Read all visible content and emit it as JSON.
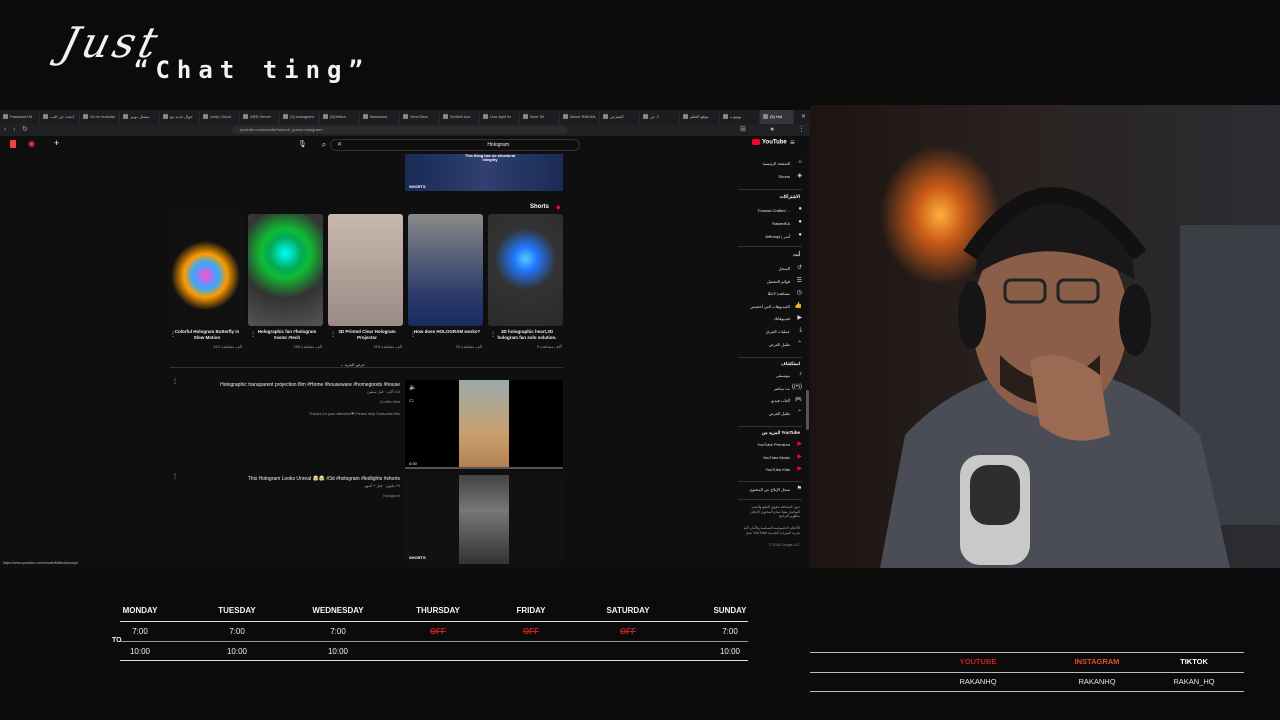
{
  "overlay": {
    "title_line1": "Just",
    "title_line2": "“Chat ting”"
  },
  "browser": {
    "tabs": [
      "Password M",
      "ابحث عن التب",
      "Go to recitatio",
      "مشغل نوبير",
      "جوال جديد مع",
      "Unity Cloud",
      "ARB Server",
      "(3) Instagram",
      "(8)Telbot",
      "Blackrock",
      "VirusTotal",
      "ScribAI doc",
      "Live April th",
      "Now Tel",
      "About RAKAN",
      "المعرض",
      "عن Z",
      "موقع التعلم",
      "يوتيوب",
      "(5) Hol"
    ],
    "url": "youtube.com/results?search_query=hologram+",
    "search_value": "Hologram",
    "yt_logo": "YouTube"
  },
  "results": {
    "top_short_caption": "This thing has no structural integrity",
    "shorts_label": "SHORTS",
    "shorts_header": "Shorts",
    "shorts": [
      {
        "title": "Colorful Hologram Butterfly in Slow Motion",
        "views": "812 ألف مشاهدة"
      },
      {
        "title": "Holographic fan #hologram #asmr #tech",
        "views": "288 ألف مشاهدة"
      },
      {
        "title": "3D Printed Clear Hologram Projector",
        "views": "318 ألف مشاهدة"
      },
      {
        "title": "How does HOLOGRAM works?",
        "views": "20 ألف مشاهدة"
      },
      {
        "title": "3D holographic heart,3D hologram fan solo solution.",
        "views": "9 آلاف مشاهدة"
      }
    ],
    "show_more": "عرض المزيد",
    "videos": [
      {
        "title": "Holographic transparent projection film #Home #houseware #homegoods #house",
        "meta": "١٤٨ ألف · قبل سنتين",
        "channel": "A Little Idea",
        "desc": "Thanks for your attention❤ Please help Subscribe this",
        "duration": "0:00"
      },
      {
        "title": "This Hologram Looks Unreal 🤯🤯 #3d #hologram #ledlights #shorts",
        "meta": "٢٧ مليون · قبل ٢ أشهر",
        "channel": "Hologlove",
        "desc": "",
        "duration": ""
      }
    ],
    "status_url": "https://www.youtube.com/shorts/M8kvw0uoxyA"
  },
  "sidebar": {
    "items1": [
      "الصفحة الرئيسية",
      "Shorts"
    ],
    "subs_header": "الاشتراكات",
    "subs": [
      "Tomass Crafted ...",
      "RawedKA",
      "Jeffumpi | أسر"
    ],
    "you_header": "أنت",
    "you_items": [
      "السجل",
      "قوائم التشغيل",
      "مشاهدة لاحقًا",
      "الفيديوهات التي أعجبتني",
      "فيديوهاتك",
      "عمليات التنزيل",
      "تقليل العرض"
    ],
    "explore_header": "استكشاف",
    "explore_items": [
      "موسيقى",
      "بث مباشر",
      "ألعاب فيديو",
      "تقليل العرض"
    ],
    "more_header": "المزيد من YouTube",
    "more_items": [
      "YouTube Premium",
      "YouTube Music",
      "YouTube Kids"
    ],
    "report": "سجل الإبلاغ عن المحتوى",
    "footer1": "حول  الصحافة  حقوق الطبع والنشر  التواصل معنا  صناع المحتوى  الإعلان  مطوّرو البرامج",
    "footer2": "الأحكام  الخصوصية  السياسة والأمان  آلية عمل YouTube  تجربة الميزات الجديدة",
    "copyright": "© 2024 Google LLC"
  },
  "schedule": {
    "days": [
      "MONDAY",
      "TUESDAY",
      "WEDNESDAY",
      "THURSDAY",
      "FRIDAY",
      "SATURDAY",
      "SUNDAY"
    ],
    "to_label": "TO",
    "start": [
      "7:00",
      "7:00",
      "7:00",
      "OFF",
      "OFF",
      "OFF",
      "7:00"
    ],
    "end": [
      "10:00",
      "10:00",
      "10:00",
      "",
      "",
      "",
      "10:00"
    ]
  },
  "socials": {
    "platforms": [
      "YOUTUBE",
      "INSTAGRAM",
      "TIKTOK"
    ],
    "handles": [
      "RAKANHQ",
      "RAKANHQ",
      "RAKAN_HQ"
    ],
    "colors": [
      "#cc1f1f",
      "#e0502a",
      "#ffffff"
    ]
  },
  "colors": {
    "accent_red": "#ff0033",
    "off_red": "#c42020"
  }
}
